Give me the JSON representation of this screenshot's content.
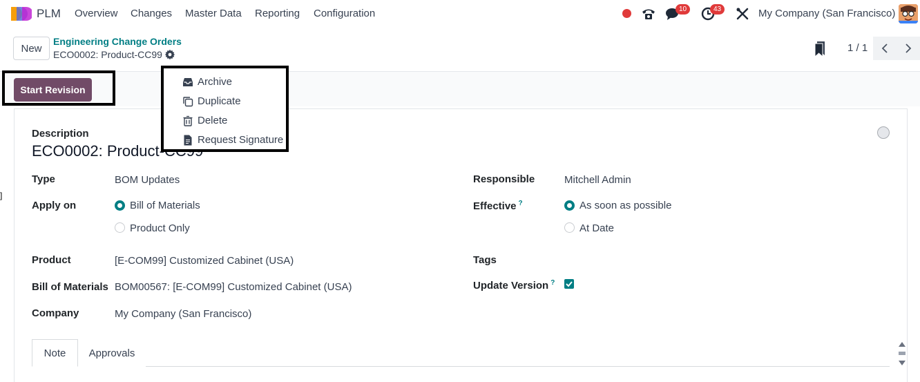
{
  "navbar": {
    "app_name": "PLM",
    "menu": [
      "Overview",
      "Changes",
      "Master Data",
      "Reporting",
      "Configuration"
    ],
    "messages_count": "10",
    "activities_count": "43",
    "company": "My Company (San Francisco)"
  },
  "control_panel": {
    "new_label": "New",
    "breadcrumb": "Engineering Change Orders",
    "record_name": "ECO0002: Product-CC99",
    "pager_value": "1 / 1"
  },
  "actions_menu": {
    "items": [
      "Archive",
      "Duplicate",
      "Delete",
      "Request Signature"
    ]
  },
  "status_bar": {
    "start_revision_label": "Start Revision"
  },
  "form": {
    "description_label": "Description",
    "title": "ECO0002: Product-CC99",
    "type_label": "Type",
    "type_value": "BOM Updates",
    "apply_on_label": "Apply on",
    "apply_on_options": [
      "Bill of Materials",
      "Product Only"
    ],
    "product_label": "Product",
    "product_value": "[E-COM99] Customized Cabinet (USA)",
    "bom_label": "Bill of Materials",
    "bom_value": "BOM00567: [E-COM99] Customized Cabinet (USA)",
    "company_label": "Company",
    "company_value": "My Company (San Francisco)",
    "responsible_label": "Responsible",
    "responsible_value": "Mitchell Admin",
    "effective_label": "Effective",
    "effective_options": [
      "As soon as possible",
      "At Date"
    ],
    "tags_label": "Tags",
    "update_version_label": "Update Version",
    "help_mark": "?",
    "update_version_checked": true
  },
  "tabs": [
    "Note",
    "Approvals"
  ],
  "colors": {
    "primary": "#714b67",
    "accent": "#017e84",
    "badge": "#e03a3a"
  }
}
